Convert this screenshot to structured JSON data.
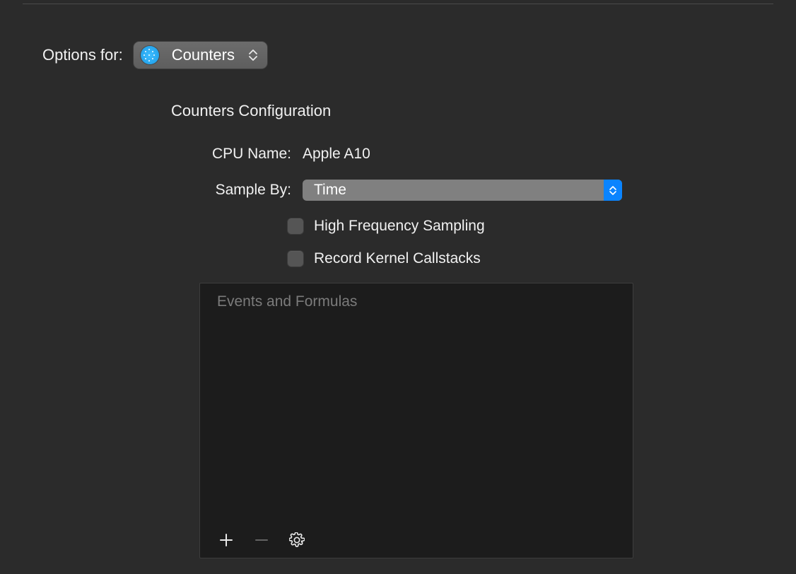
{
  "header": {
    "options_for_label": "Options for:",
    "instrument_selected": "Counters"
  },
  "section": {
    "title": "Counters Configuration",
    "cpu_name_label": "CPU Name:",
    "cpu_name_value": "Apple A10",
    "sample_by_label": "Sample By:",
    "sample_by_value": "Time",
    "high_freq_label": "High Frequency Sampling",
    "record_kernel_label": "Record Kernel Callstacks"
  },
  "events_box": {
    "placeholder": "Events and Formulas"
  }
}
